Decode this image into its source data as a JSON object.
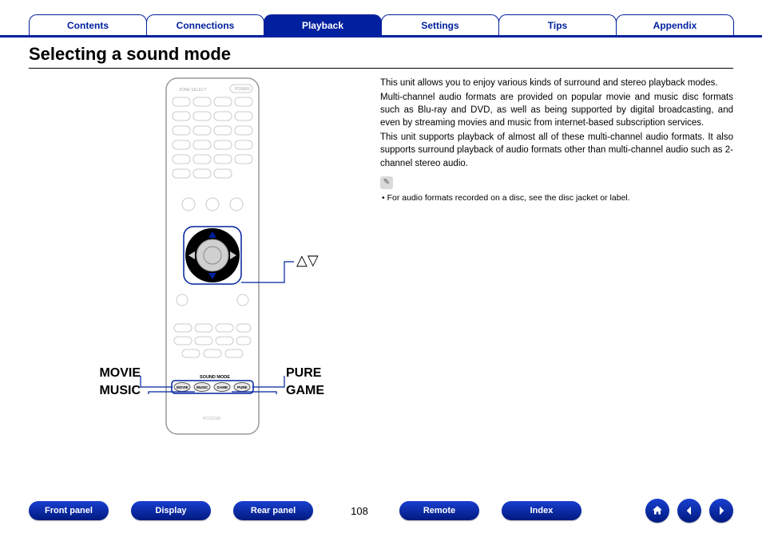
{
  "tabs": {
    "contents": "Contents",
    "connections": "Connections",
    "playback": "Playback",
    "settings": "Settings",
    "tips": "Tips",
    "appendix": "Appendix"
  },
  "title": "Selecting a sound mode",
  "body": {
    "p1": "This unit allows you to enjoy various kinds of surround and stereo playback modes.",
    "p2": "Multi-channel audio formats are provided on popular movie and music disc formats such as Blu-ray and DVD, as well as being supported by digital broadcasting, and even by streaming movies and music from internet-based subscription services.",
    "p3": "This unit supports playback of almost all of these multi-channel audio formats. It also supports surround playback of audio formats other than multi-channel audio such as 2-channel stereo audio.",
    "note_bullet": "For audio formats recorded on a disc, see the disc jacket or label."
  },
  "callouts": {
    "updown": "△▽",
    "movie": "MOVIE",
    "music": "MUSIC",
    "pure": "PURE",
    "game": "GAME"
  },
  "remote": {
    "zone_select": "ZONE SELECT",
    "power": "POWER",
    "sound_mode": "SOUND MODE",
    "movie": "MOVIE",
    "music": "MUSIC",
    "game": "GAME",
    "pure": "PURE",
    "model": "RC022SR"
  },
  "footer": {
    "front_panel": "Front panel",
    "display": "Display",
    "rear_panel": "Rear panel",
    "remote": "Remote",
    "index": "Index",
    "page": "108"
  }
}
